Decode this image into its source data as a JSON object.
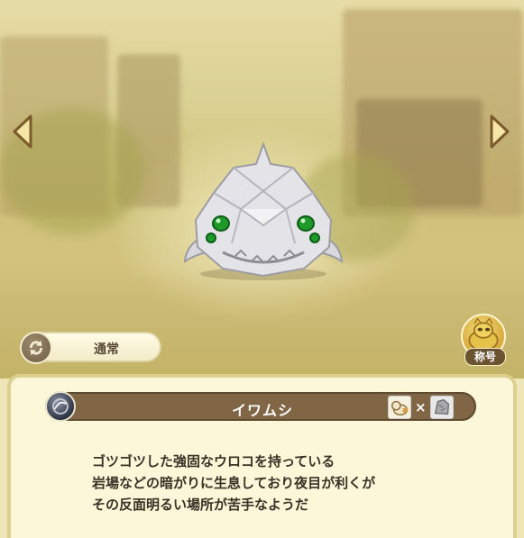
{
  "navigation": {
    "prev_icon": "left-arrow-icon",
    "next_icon": "right-arrow-icon"
  },
  "monster": {
    "name": "イワムシ",
    "icon": "rock-bug-monster"
  },
  "mode": {
    "label": "通常",
    "icon": "refresh-icon"
  },
  "title_button": {
    "label": "称号",
    "icon": "title-badge-icon"
  },
  "combo": {
    "separator": "×",
    "left_icon": "cat-creature-card",
    "right_icon": "rock-card"
  },
  "description": {
    "lines": [
      "ゴツゴツした強固なウロコを持っている",
      "岩場などの暗がりに生息しており夜目が利くが",
      "その反面明るい場所が苦手なようだ"
    ]
  },
  "colors": {
    "panel": "#fbf7d8",
    "name_bar": "#806645",
    "accent_gold": "#d8a83a",
    "eye_green": "#1f9a2a"
  }
}
